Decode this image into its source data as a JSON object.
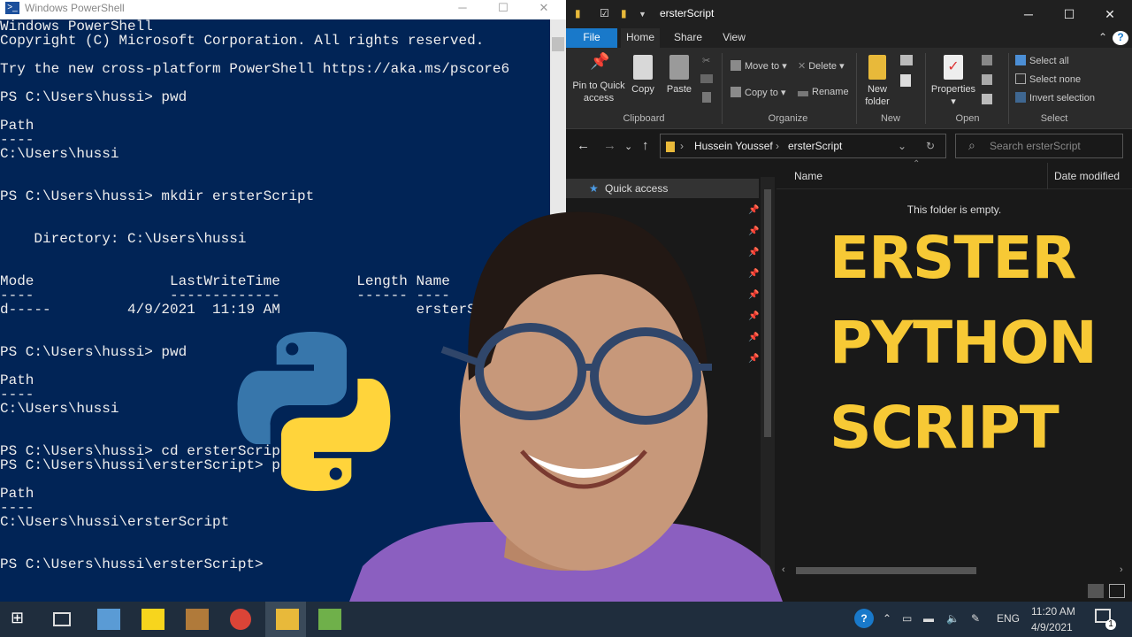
{
  "powershell": {
    "title": "Windows PowerShell",
    "lines": [
      "Windows PowerShell",
      "Copyright (C) Microsoft Corporation. All rights reserved.",
      "",
      "Try the new cross-platform PowerShell https://aka.ms/pscore6",
      "",
      "PS C:\\Users\\hussi> pwd",
      "",
      "Path",
      "----",
      "C:\\Users\\hussi",
      "",
      "",
      "PS C:\\Users\\hussi> mkdir ersterScript",
      "",
      "",
      "    Directory: C:\\Users\\hussi",
      "",
      "",
      "Mode                LastWriteTime         Length Name",
      "----                -------------         ------ ----",
      "d-----         4/9/2021  11:19 AM                ersterScri",
      "",
      "",
      "PS C:\\Users\\hussi> pwd",
      "",
      "Path",
      "----",
      "C:\\Users\\hussi",
      "",
      "",
      "PS C:\\Users\\hussi> cd ersterScrip",
      "PS C:\\Users\\hussi\\ersterScript> p",
      "",
      "Path",
      "----",
      "C:\\Users\\hussi\\ersterScript",
      "",
      "",
      "PS C:\\Users\\hussi\\ersterScript>"
    ]
  },
  "explorer": {
    "title": "ersterScript",
    "tabs": {
      "file": "File",
      "home": "Home",
      "share": "Share",
      "view": "View"
    },
    "ribbon": {
      "pin_line1": "Pin to Quick",
      "pin_line2": "access",
      "copy": "Copy",
      "paste": "Paste",
      "move_to": "Move to",
      "copy_to": "Copy to",
      "delete": "Delete",
      "rename": "Rename",
      "new_folder_line1": "New",
      "new_folder_line2": "folder",
      "properties": "Properties",
      "select_all": "Select all",
      "select_none": "Select none",
      "invert_selection": "Invert selection",
      "groups": {
        "clipboard": "Clipboard",
        "organize": "Organize",
        "new": "New",
        "open": "Open",
        "select": "Select"
      }
    },
    "address": {
      "crumb1": "Hussein Youssef",
      "crumb2": "ersterScript"
    },
    "search_placeholder": "Search ersterScript",
    "nav_pane": {
      "quick_access": "Quick access"
    },
    "columns": {
      "name": "Name",
      "date_modified": "Date modified"
    },
    "empty_message": "This folder is empty."
  },
  "overlay": {
    "line1": "ERSTER",
    "line2": "PYTHON",
    "line3": "SCRIPT"
  },
  "taskbar": {
    "lang": "ENG",
    "time": "11:20 AM",
    "date": "4/9/2021",
    "notif_count": "1"
  }
}
